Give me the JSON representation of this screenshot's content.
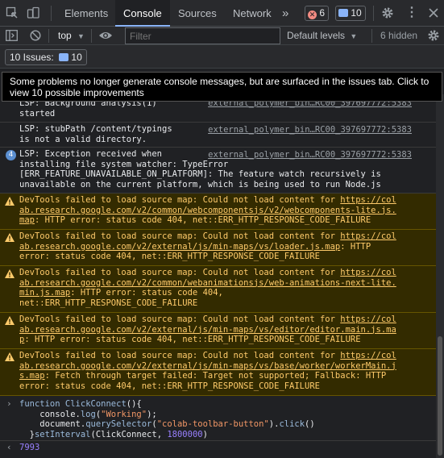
{
  "tabs": {
    "items": [
      "Elements",
      "Console",
      "Sources",
      "Network"
    ],
    "more": "»",
    "errors_count": "6",
    "messages_count": "10"
  },
  "toolbar": {
    "context": "top",
    "filter_placeholder": "Filter",
    "levels": "Default levels",
    "hidden": "6 hidden"
  },
  "issues": {
    "label": "10 Issues:",
    "count": "10"
  },
  "tooltip": {
    "text": "Some problems no longer generate console messages, but are surfaced in the issues tab. Click to view 10 possible improvements"
  },
  "log": {
    "lsp1_line1": "LSP: Background analysis(1)",
    "lsp1_line2": "started",
    "lsp1_src": "external_polymer_bin…RC00_397697772:5383",
    "lsp2_line1": "LSP: stubPath /content/typings",
    "lsp2_line2": "is not a valid directory.",
    "lsp2_src": "external_polymer_bin…RC00_397697772:5383",
    "lsp3_count": "4",
    "lsp3_line1": "LSP: Exception received when",
    "lsp3_line2": "installing file system watcher: TypeError",
    "lsp3_line3": "[ERR_FEATURE_UNAVAILABLE_ON_PLATFORM]: The feature watch recursively is",
    "lsp3_line4": "unavailable on the current platform, which is being used to run Node.js",
    "lsp3_src": "external_polymer_bin…RC00_397697772:5383",
    "w1_a": "DevTools failed to load source map: Could not load content for ",
    "w1_link1": "https://col",
    "w1_link2": "ab.research.google.com/v2/common/webcomponentsjs/v2/webcomponents-lite.js.",
    "w1_link3": "map",
    "w1_b": ": HTTP error: status code 404, net::ERR_HTTP_RESPONSE_CODE_FAILURE",
    "w2_a": "DevTools failed to load source map: Could not load content for ",
    "w2_link1": "https://col",
    "w2_link2": "ab.research.google.com/v2/external/js/min-maps/vs/loader.js.map",
    "w2_b": ": HTTP",
    "w2_c": "error: status code 404, net::ERR_HTTP_RESPONSE_CODE_FAILURE",
    "w3_a": "DevTools failed to load source map: Could not load content for ",
    "w3_link1": "https://col",
    "w3_link2": "ab.research.google.com/v2/common/webanimationsjs/web-animations-next-lite.",
    "w3_link3": "min.js.map",
    "w3_b": ": HTTP error: status code 404,",
    "w3_c": "net::ERR_HTTP_RESPONSE_CODE_FAILURE",
    "w4_a": "DevTools failed to load source map: Could not load content for ",
    "w4_link1": "https://col",
    "w4_link2": "ab.research.google.com/v2/external/js/min-maps/vs/editor/editor.main.js.ma",
    "w4_link3": "p",
    "w4_b": ": HTTP error: status code 404, net::ERR_HTTP_RESPONSE_CODE_FAILURE",
    "w5_a": "DevTools failed to load source map: Could not load content for ",
    "w5_link1": "https://col",
    "w5_link2": "ab.research.google.com/v2/external/js/min-maps/vs/base/worker/workerMain.j",
    "w5_link3": "s.map",
    "w5_b": ": Fetch through target failed: Target not supported; Fallback: HTTP",
    "w5_c": "error: status code 404, net::ERR_HTTP_RESPONSE_CODE_FAILURE"
  },
  "input": {
    "l1_kw": "function",
    "l1_fn": "ClickConnect",
    "l1_rest": "(){",
    "l2_a": "    console.",
    "l2_fn": "log",
    "l2_b": "(",
    "l2_str": "\"Working\"",
    "l2_c": ");",
    "l3_a": "    document.",
    "l3_fn": "querySelector",
    "l3_b": "(",
    "l3_str": "\"colab-toolbar-button\"",
    "l3_c": ").",
    "l3_fn2": "click",
    "l3_d": "()",
    "l4_a": "  }",
    "l4_fn": "setInterval",
    "l4_b": "(ClickConnect, ",
    "l4_num": "1800000",
    "l4_c": ")",
    "result": "7993"
  },
  "colors": {
    "accent": "#8ab4f8",
    "warning_bg": "#332b00",
    "warning_text": "#ffcb6b",
    "error_badge": "#f28b82"
  }
}
